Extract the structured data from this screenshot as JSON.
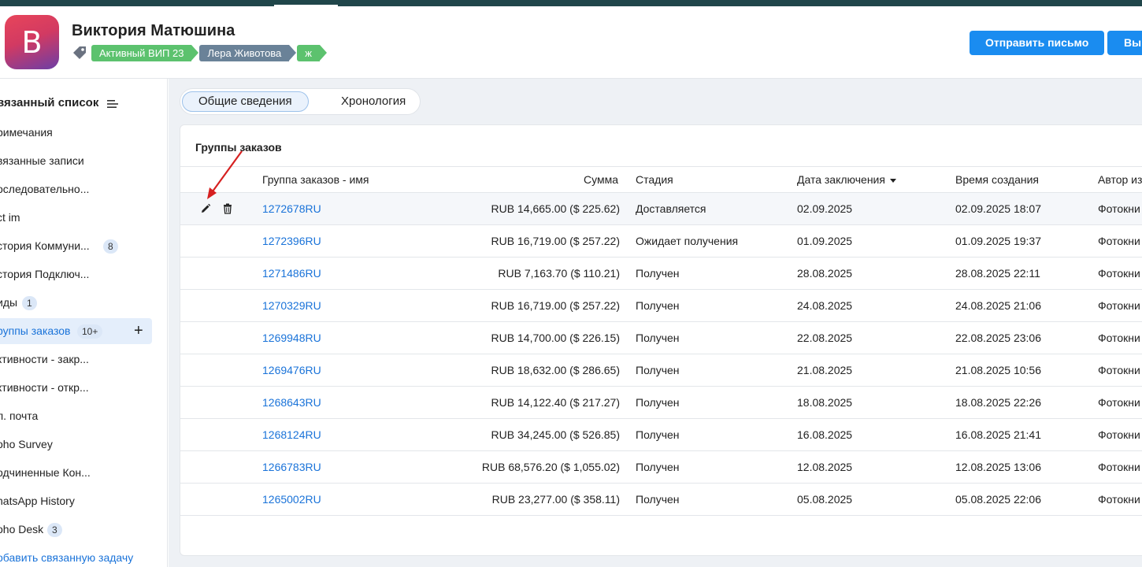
{
  "header": {
    "avatar_letter": "В",
    "contact_name": "Виктория Матюшина",
    "tags": [
      {
        "label": "Активный ВИП 23",
        "color": "#5cc26e"
      },
      {
        "label": "Лера Животова",
        "color": "#6a8298"
      },
      {
        "label": "ж",
        "color": "#5cc26e"
      }
    ],
    "send_email_label": "Отправить письмо",
    "more_button_label": "Вы"
  },
  "sidebar": {
    "title": "вязанный список",
    "items": [
      {
        "label": "римечания",
        "badge": ""
      },
      {
        "label": "вязанные записи",
        "badge": ""
      },
      {
        "label": "оследовательно...",
        "badge": ""
      },
      {
        "label": "ct im",
        "badge": ""
      },
      {
        "label": "стория Коммуни...",
        "badge": "8"
      },
      {
        "label": "стория Подключ...",
        "badge": ""
      },
      {
        "label": "иды",
        "badge": "1"
      },
      {
        "label": "руппы заказов",
        "badge": "10+"
      },
      {
        "label": "ктивности - закр...",
        "badge": ""
      },
      {
        "label": "ктивности - откр...",
        "badge": ""
      },
      {
        "label": "л. почта",
        "badge": ""
      },
      {
        "label": "oho Survey",
        "badge": ""
      },
      {
        "label": "одчиненные Кон...",
        "badge": ""
      },
      {
        "label": "hatsApp History",
        "badge": ""
      },
      {
        "label": "oho Desk",
        "badge": "3"
      }
    ],
    "add_task_link": "обавить связанную задачу"
  },
  "main": {
    "tabs": [
      {
        "label": "Общие сведения"
      },
      {
        "label": "Хронология"
      }
    ],
    "card_title": "Группы заказов",
    "columns": {
      "name": "Группа заказов - имя",
      "amount": "Сумма",
      "stage": "Стадия",
      "close_date": "Дата заключения",
      "created": "Время создания",
      "author": "Автор из"
    },
    "rows": [
      {
        "name": "1272678RU",
        "amount": "RUB 14,665.00 ($ 225.62)",
        "stage": "Доставляется",
        "close_date": "02.09.2025",
        "created": "02.09.2025 18:07",
        "author": "Фотокни"
      },
      {
        "name": "1272396RU",
        "amount": "RUB 16,719.00 ($ 257.22)",
        "stage": "Ожидает получения",
        "close_date": "01.09.2025",
        "created": "01.09.2025 19:37",
        "author": "Фотокни"
      },
      {
        "name": "1271486RU",
        "amount": "RUB 7,163.70 ($ 110.21)",
        "stage": "Получен",
        "close_date": "28.08.2025",
        "created": "28.08.2025 22:11",
        "author": "Фотокни"
      },
      {
        "name": "1270329RU",
        "amount": "RUB 16,719.00 ($ 257.22)",
        "stage": "Получен",
        "close_date": "24.08.2025",
        "created": "24.08.2025 21:06",
        "author": "Фотокни"
      },
      {
        "name": "1269948RU",
        "amount": "RUB 14,700.00 ($ 226.15)",
        "stage": "Получен",
        "close_date": "22.08.2025",
        "created": "22.08.2025 23:06",
        "author": "Фотокни"
      },
      {
        "name": "1269476RU",
        "amount": "RUB 18,632.00 ($ 286.65)",
        "stage": "Получен",
        "close_date": "21.08.2025",
        "created": "21.08.2025 10:56",
        "author": "Фотокни"
      },
      {
        "name": "1268643RU",
        "amount": "RUB 14,122.40 ($ 217.27)",
        "stage": "Получен",
        "close_date": "18.08.2025",
        "created": "18.08.2025 22:26",
        "author": "Фотокни"
      },
      {
        "name": "1268124RU",
        "amount": "RUB 34,245.00 ($ 526.85)",
        "stage": "Получен",
        "close_date": "16.08.2025",
        "created": "16.08.2025 21:41",
        "author": "Фотокни"
      },
      {
        "name": "1266783RU",
        "amount": "RUB 68,576.20 ($ 1,055.02)",
        "stage": "Получен",
        "close_date": "12.08.2025",
        "created": "12.08.2025 13:06",
        "author": "Фотокни"
      },
      {
        "name": "1265002RU",
        "amount": "RUB 23,277.00 ($ 358.11)",
        "stage": "Получен",
        "close_date": "05.08.2025",
        "created": "05.08.2025 22:06",
        "author": "Фотокни"
      }
    ]
  },
  "colors": {
    "accent": "#1a8cf0",
    "link": "#1a73d9",
    "topbar": "#20464a",
    "annotation_arrow": "#d62020"
  }
}
